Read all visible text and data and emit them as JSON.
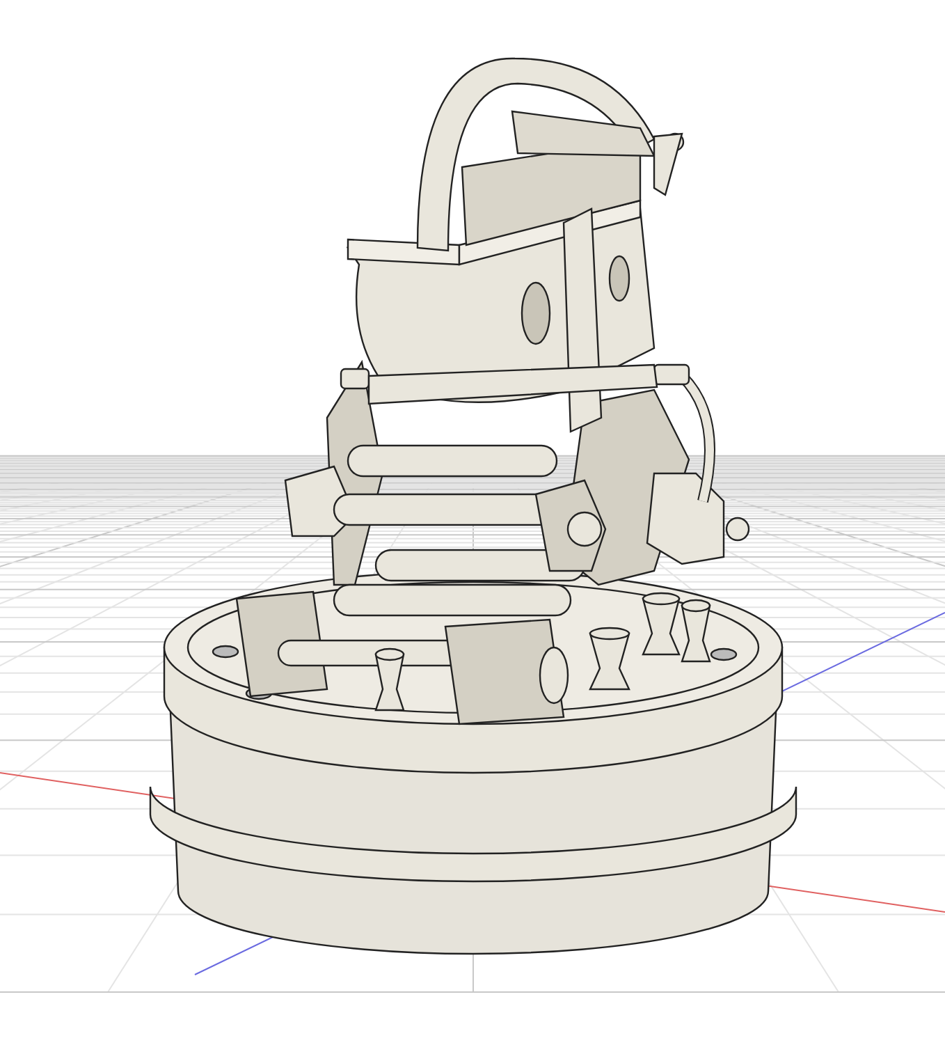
{
  "viewport": {
    "grid_visible": true,
    "axes_visible": true,
    "model": {
      "kind": "mechanism"
    }
  }
}
